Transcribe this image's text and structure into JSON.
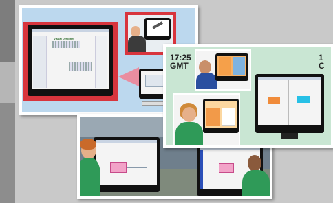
{
  "scene_a": {
    "window_title": "Visual Designer",
    "colors": {
      "background": "#bcd8ee",
      "frame": "#d8353d"
    }
  },
  "scene_b": {
    "time_label_1": "17:25",
    "time_zone_1": "GMT",
    "time_label_2": "1",
    "time_zone_2": "C",
    "colors": {
      "background": "#c9e6d3",
      "orange": "#f08b3a",
      "cyan": "#27c0e6"
    }
  },
  "scene_c": {
    "colors": {
      "pink": "#f2a3c8"
    }
  }
}
